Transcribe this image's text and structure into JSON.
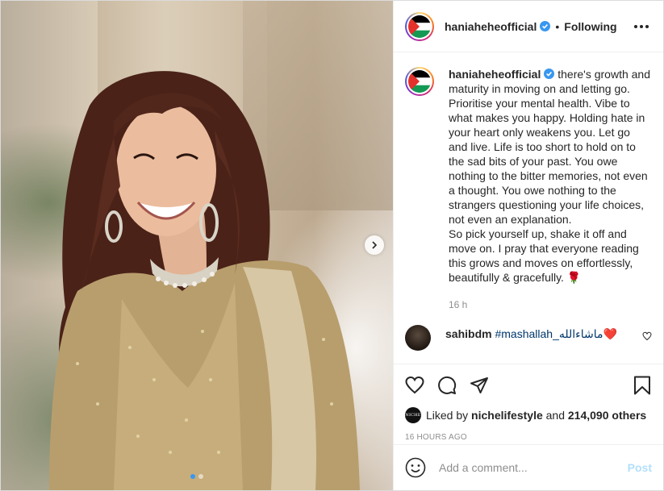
{
  "post": {
    "username": "haniaheheofficial",
    "follow_status": "Following",
    "separator": "•",
    "caption_username": "haniaheheofficial",
    "caption": "there's growth and maturity in moving on and letting go. Prioritise your mental health. Vibe to what makes you happy. Holding hate in your heart only weakens you. Let go and live. Life is too short to hold on to the sad bits of your past. You owe nothing to the bitter memories, not even a thought. You owe nothing to the strangers questioning your life choices, not even an explanation.\nSo pick yourself up, shake it off and move on. I pray that everyone reading this grows and moves on effortlessly, beautifully & gracefully. 🌹",
    "time_ago": "16 h"
  },
  "comments": [
    {
      "username": "sahibdm",
      "hashtag": "#mashallah_ماشاءالله",
      "emoji": "❤️"
    }
  ],
  "likes": {
    "prefix": "Liked by",
    "first_liker": "nichelifestyle",
    "connector": "and",
    "others": "214,090 others",
    "liker_avatar_text": "NICHE"
  },
  "posted_time": "16 HOURS AGO",
  "add_comment": {
    "placeholder": "Add a comment...",
    "post_label": "Post"
  },
  "carousel": {
    "slides": 2,
    "active": 0
  },
  "icons": [
    "verified-badge-icon",
    "more-options-icon",
    "heart-icon",
    "comment-icon",
    "share-icon",
    "bookmark-icon",
    "emoji-icon",
    "chevron-right-icon"
  ],
  "colors": {
    "verified": "#3897f0",
    "post_disabled": "#b2dffc",
    "text": "#262626",
    "muted": "#8e8e8e"
  }
}
